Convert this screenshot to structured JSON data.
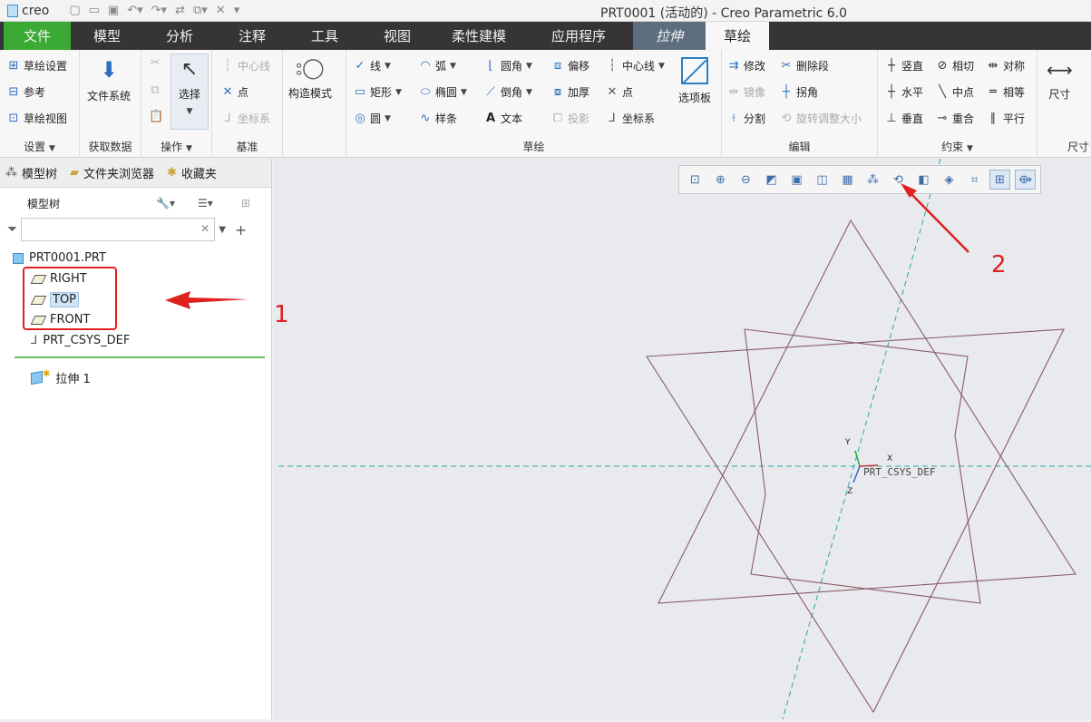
{
  "app": {
    "logo": "creo",
    "title": "PRT0001 (活动的) - Creo Parametric 6.0"
  },
  "tabs": [
    {
      "label": "文件"
    },
    {
      "label": "模型"
    },
    {
      "label": "分析"
    },
    {
      "label": "注释"
    },
    {
      "label": "工具"
    },
    {
      "label": "视图"
    },
    {
      "label": "柔性建模"
    },
    {
      "label": "应用程序"
    },
    {
      "label": "拉伸"
    },
    {
      "label": "草绘"
    }
  ],
  "ribbon": {
    "setup": {
      "label": "设置",
      "items": [
        "草绘设置",
        "参考",
        "草绘视图"
      ]
    },
    "data": {
      "label": "获取数据",
      "file_system": "文件系统"
    },
    "ops": {
      "label": "操作",
      "select": "选择"
    },
    "datum": {
      "label": "基准",
      "items": [
        "中心线",
        "点",
        "坐标系"
      ]
    },
    "construct": {
      "label": "构造模式"
    },
    "sketch": {
      "label": "草绘",
      "col1": [
        "线",
        "矩形",
        "圆"
      ],
      "col2": [
        "弧",
        "椭圆",
        "样条"
      ],
      "col3": [
        "圆角",
        "倒角",
        "文本"
      ],
      "col4": [
        "偏移",
        "加厚",
        "投影"
      ],
      "col5": [
        "中心线",
        "点",
        "坐标系"
      ],
      "palette": "选项板"
    },
    "edit": {
      "label": "编辑",
      "items": [
        "修改",
        "删除段",
        "镜像",
        "拐角",
        "分割",
        "旋转调整大小"
      ]
    },
    "constrain": {
      "label": "约束",
      "items": [
        "竖直",
        "相切",
        "对称",
        "水平",
        "中点",
        "相等",
        "垂直",
        "重合",
        "平行"
      ]
    },
    "dimension": {
      "label": "尺寸",
      "item": "尺寸"
    }
  },
  "sidebar": {
    "tabs": [
      "模型树",
      "文件夹浏览器",
      "收藏夹"
    ],
    "header": "模型树",
    "filter_value": "",
    "tree": [
      {
        "label": "PRT0001.PRT"
      },
      {
        "label": "RIGHT"
      },
      {
        "label": "TOP"
      },
      {
        "label": "FRONT"
      },
      {
        "label": "PRT_CSYS_DEF"
      },
      {
        "label": "拉伸 1"
      }
    ]
  },
  "canvas": {
    "csys_label": "PRT_CSYS_DEF",
    "axis_x": "X",
    "axis_y": "Y",
    "axis_z": "Z"
  },
  "annotations": {
    "one": "1",
    "two": "2"
  },
  "colors": {
    "file_tab": "#3aaa35",
    "ctx_tab": "#5d6f7f",
    "annotation": "#e02020",
    "sketch_line": "#8a5a68",
    "axis_line": "#2aa6a6"
  }
}
